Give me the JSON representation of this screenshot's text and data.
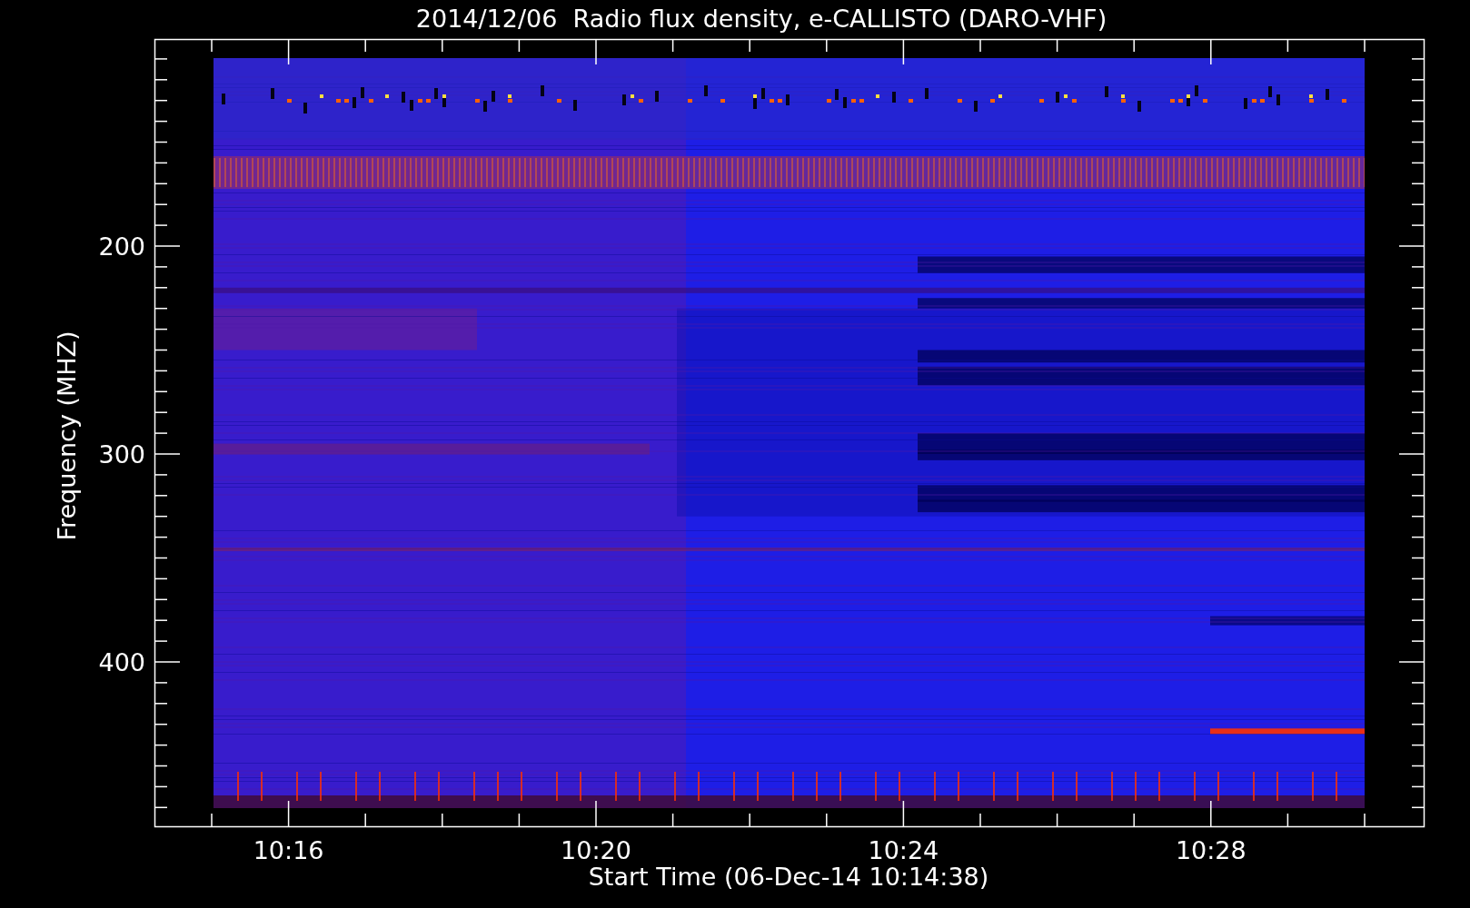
{
  "title": "2014/12/06  Radio flux density, e-CALLISTO (DARO-VHF)",
  "y_axis": {
    "label": "Frequency (MHZ)",
    "ticks": [
      "200",
      "300",
      "400"
    ]
  },
  "x_axis": {
    "label": "Start Time (06-Dec-14 10:14:38)",
    "ticks": [
      "10:16",
      "10:20",
      "10:24",
      "10:28"
    ]
  }
}
